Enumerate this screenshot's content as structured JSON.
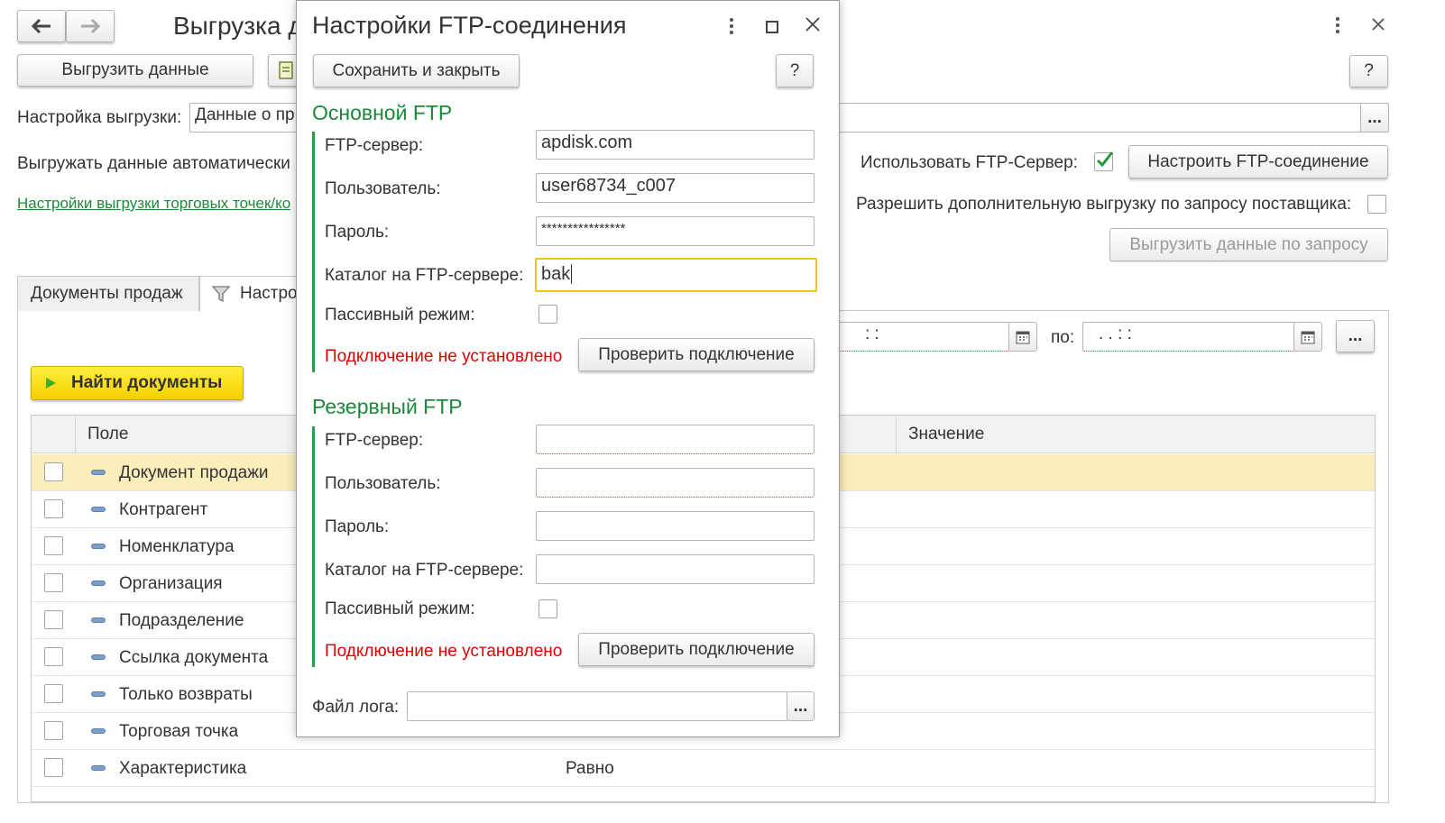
{
  "main": {
    "title": "Выгрузка д",
    "export_button": "Выгрузить данные",
    "help_button": "?",
    "setting_label": "Настройка выгрузки:",
    "setting_value": "Данные о пр",
    "select_button": "...",
    "auto_export_label": "Выгружать данные автоматически",
    "outlets_link": "Настройки выгрузки торговых точек/ко",
    "use_ftp_label": "Использовать FTP-Сервер:",
    "use_ftp_checked": true,
    "configure_ftp_button": "Настроить FTP-соединение",
    "allow_extra_label": "Разрешить дополнительную выгрузку по запросу поставщика:",
    "allow_extra_checked": false,
    "export_on_request_button": "Выгрузить данные по запросу",
    "tabs": [
      {
        "label": "Документы продаж",
        "active": false
      },
      {
        "label": "Настро",
        "active": true,
        "icon": "filter-icon"
      }
    ],
    "date_to_label": "по:",
    "date_from_value": " :  :",
    "date_to_value": ".  .      :  :",
    "period_button": "...",
    "find_button": "Найти документы",
    "grid": {
      "columns": [
        "Поле",
        "Значение"
      ],
      "rows": [
        {
          "field": "Документ продажи",
          "comparison": "",
          "selected": true
        },
        {
          "field": "Контрагент",
          "comparison": ""
        },
        {
          "field": "Номенклатура",
          "comparison": ""
        },
        {
          "field": "Организация",
          "comparison": ""
        },
        {
          "field": "Подразделение",
          "comparison": ""
        },
        {
          "field": "Ссылка документа",
          "comparison": ""
        },
        {
          "field": "Только возвраты",
          "comparison": ""
        },
        {
          "field": "Торговая точка",
          "comparison": ""
        },
        {
          "field": "Характеристика",
          "comparison": "Равно"
        }
      ]
    }
  },
  "dialog": {
    "title": "Настройки FTP-соединения",
    "save_close_button": "Сохранить и закрыть",
    "help_button": "?",
    "primary": {
      "title": "Основной FTP",
      "server_label": "FTP-сервер:",
      "server_value": "apdisk.com",
      "user_label": "Пользователь:",
      "user_value": "user68734_c007",
      "password_label": "Пароль:",
      "password_value": "****************",
      "dir_label": "Каталог на FTP-сервере:",
      "dir_value": "bak",
      "passive_label": "Пассивный режим:",
      "status": "Подключение не установлено",
      "check_button": "Проверить подключение"
    },
    "backup": {
      "title": "Резервный FTP",
      "server_label": "FTP-сервер:",
      "server_value": "",
      "user_label": "Пользователь:",
      "user_value": "",
      "password_label": "Пароль:",
      "password_value": "",
      "dir_label": "Каталог на FTP-сервере:",
      "dir_value": "",
      "passive_label": "Пассивный режим:",
      "status": "Подключение не установлено",
      "check_button": "Проверить подключение"
    },
    "log_label": "Файл лога:",
    "log_value": "",
    "log_select_button": "..."
  },
  "colors": {
    "accent_green": "#1a8a3a",
    "error_red": "#e00000",
    "selected_row": "#fbeebb",
    "find_button_yellow": "#f5d000"
  }
}
